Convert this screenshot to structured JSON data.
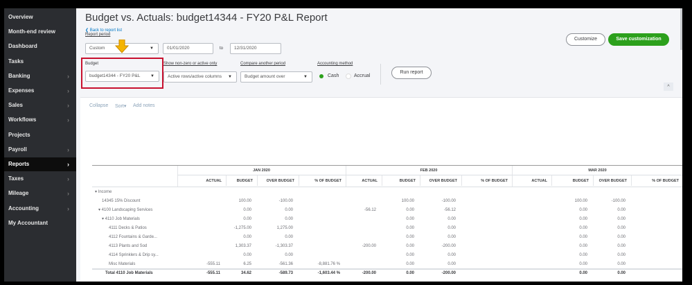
{
  "sidebar": {
    "items": [
      {
        "label": "Overview",
        "chevron": false
      },
      {
        "label": "Month-end review",
        "chevron": false
      },
      {
        "label": "Dashboard",
        "chevron": false
      },
      {
        "label": "Tasks",
        "chevron": false
      },
      {
        "label": "Banking",
        "chevron": true
      },
      {
        "label": "Expenses",
        "chevron": true
      },
      {
        "label": "Sales",
        "chevron": true
      },
      {
        "label": "Workflows",
        "chevron": true
      },
      {
        "label": "Projects",
        "chevron": false
      },
      {
        "label": "Payroll",
        "chevron": true
      },
      {
        "label": "Reports",
        "chevron": true,
        "active": true
      },
      {
        "label": "Taxes",
        "chevron": true
      },
      {
        "label": "Mileage",
        "chevron": true
      },
      {
        "label": "Accounting",
        "chevron": true
      },
      {
        "label": "My Accountant",
        "chevron": false
      }
    ],
    "chevron": "›"
  },
  "header": {
    "title": "Budget vs. Actuals: budget14344 - FY20 P&L Report",
    "back_link": "❮ Back to report list",
    "customize": "Customize",
    "save": "Save customization"
  },
  "filters": {
    "report_period_label": "Report period",
    "report_period": "Custom",
    "from": "01/01/2020",
    "to_label": "to",
    "to": "12/31/2020",
    "budget_label": "Budget",
    "budget": "budget14344 - FY20 P&L",
    "nonzero_label": "Show non-zero or active only",
    "nonzero": "Active rows/active columns",
    "compare_label": "Compare another period",
    "compare": "Budget amount over",
    "method_label": "Accounting method",
    "cash": "Cash",
    "accrual": "Accrual",
    "method_selected": "Cash",
    "run": "Run report",
    "caret": "▼",
    "collapse_icon": "^"
  },
  "toolbar": {
    "collapse": "Collapse",
    "sort": "Sort▾",
    "notes": "Add notes"
  },
  "table": {
    "months": [
      "JAN 2020",
      "FEB 2020",
      "MAR 2020"
    ],
    "columns": [
      "ACTUAL",
      "BUDGET",
      "OVER BUDGET",
      "% OF BUDGET"
    ],
    "rows": [
      {
        "label": "▾ Income",
        "indent": 0,
        "cells": [
          "",
          "",
          "",
          "",
          "",
          "",
          "",
          "",
          "",
          "",
          "",
          ""
        ]
      },
      {
        "label": "14345 15% Discount",
        "indent": 1,
        "cells": [
          "",
          "100.00",
          "-100.00",
          "",
          "",
          "100.00",
          "-100.00",
          "",
          "",
          "100.00",
          "-100.00",
          ""
        ]
      },
      {
        "label": "▾ 4100 Landscaping Services",
        "indent": 0.5,
        "cells": [
          "",
          "0.00",
          "0.00",
          "",
          "-56.12",
          "0.00",
          "-56.12",
          "",
          "",
          "0.00",
          "0.00",
          ""
        ]
      },
      {
        "label": "▾ 4110 Job Materials",
        "indent": 1,
        "cells": [
          "",
          "0.00",
          "0.00",
          "",
          "",
          "0.00",
          "0.00",
          "",
          "",
          "0.00",
          "0.00",
          ""
        ]
      },
      {
        "label": "4111 Decks & Patios",
        "indent": 2,
        "cells": [
          "",
          "-1,275.00",
          "1,275.00",
          "",
          "",
          "0.00",
          "0.00",
          "",
          "",
          "0.00",
          "0.00",
          ""
        ]
      },
      {
        "label": "4112 Fountains & Garde...",
        "indent": 2,
        "cells": [
          "",
          "0.00",
          "0.00",
          "",
          "",
          "0.00",
          "0.00",
          "",
          "",
          "0.00",
          "0.00",
          ""
        ]
      },
      {
        "label": "4113 Plants and Sod",
        "indent": 2,
        "cells": [
          "",
          "1,303.37",
          "-1,303.37",
          "",
          "-200.00",
          "0.00",
          "-200.00",
          "",
          "",
          "0.00",
          "0.00",
          ""
        ]
      },
      {
        "label": "4114 Sprinklers & Drip sy...",
        "indent": 2,
        "cells": [
          "",
          "0.00",
          "0.00",
          "",
          "",
          "0.00",
          "0.00",
          "",
          "",
          "0.00",
          "0.00",
          ""
        ]
      },
      {
        "label": "Misc Materials",
        "indent": 2,
        "cells": [
          "-555.11",
          "6.25",
          "-561.36",
          "-8,881.76 %",
          "",
          "0.00",
          "0.00",
          "",
          "",
          "0.00",
          "0.00",
          ""
        ]
      },
      {
        "label": "Total 4110 Job Materials",
        "indent": 1.5,
        "total": true,
        "cells": [
          "-555.11",
          "34.62",
          "-589.73",
          "-1,603.44 %",
          "-200.00",
          "0.00",
          "-200.00",
          "",
          "",
          "0.00",
          "0.00",
          ""
        ]
      }
    ]
  }
}
